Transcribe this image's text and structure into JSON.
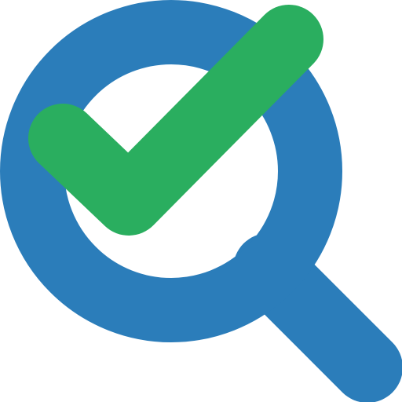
{
  "icon": {
    "name": "search-check-icon",
    "colors": {
      "background": "#ffffff",
      "magnifier": "#2B7DBA",
      "check": "#2AAE5F"
    }
  }
}
